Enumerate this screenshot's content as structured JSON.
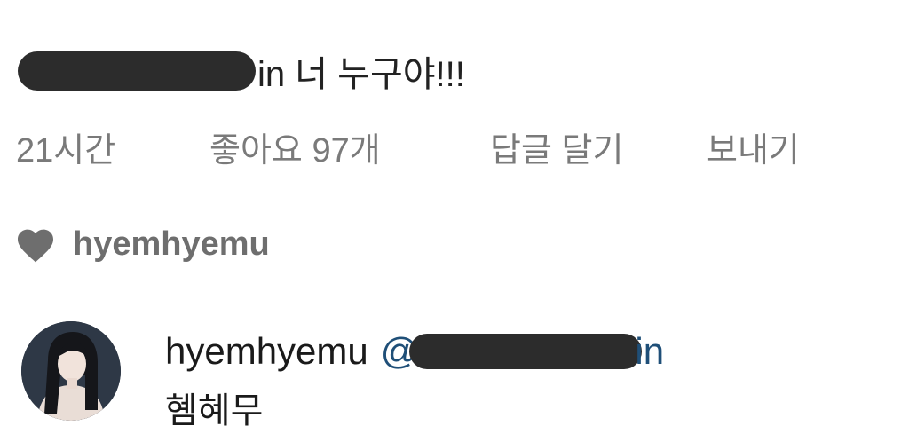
{
  "comment": {
    "text_tail": "in 너 누구야!!!"
  },
  "meta": {
    "time": "21시간",
    "likes": "좋아요 97개",
    "reply": "답글 달기",
    "send": "보내기"
  },
  "liked_by": {
    "username": "hyemhyemu"
  },
  "reply": {
    "username": "hyemhyemu",
    "mention_prefix": "@",
    "mention_suffix": "in",
    "text": "혬혜무"
  },
  "colors": {
    "text_primary": "#1a1a1a",
    "text_secondary": "#7a7a7a",
    "mention": "#1f4f78",
    "redaction": "#2c2c2c"
  }
}
